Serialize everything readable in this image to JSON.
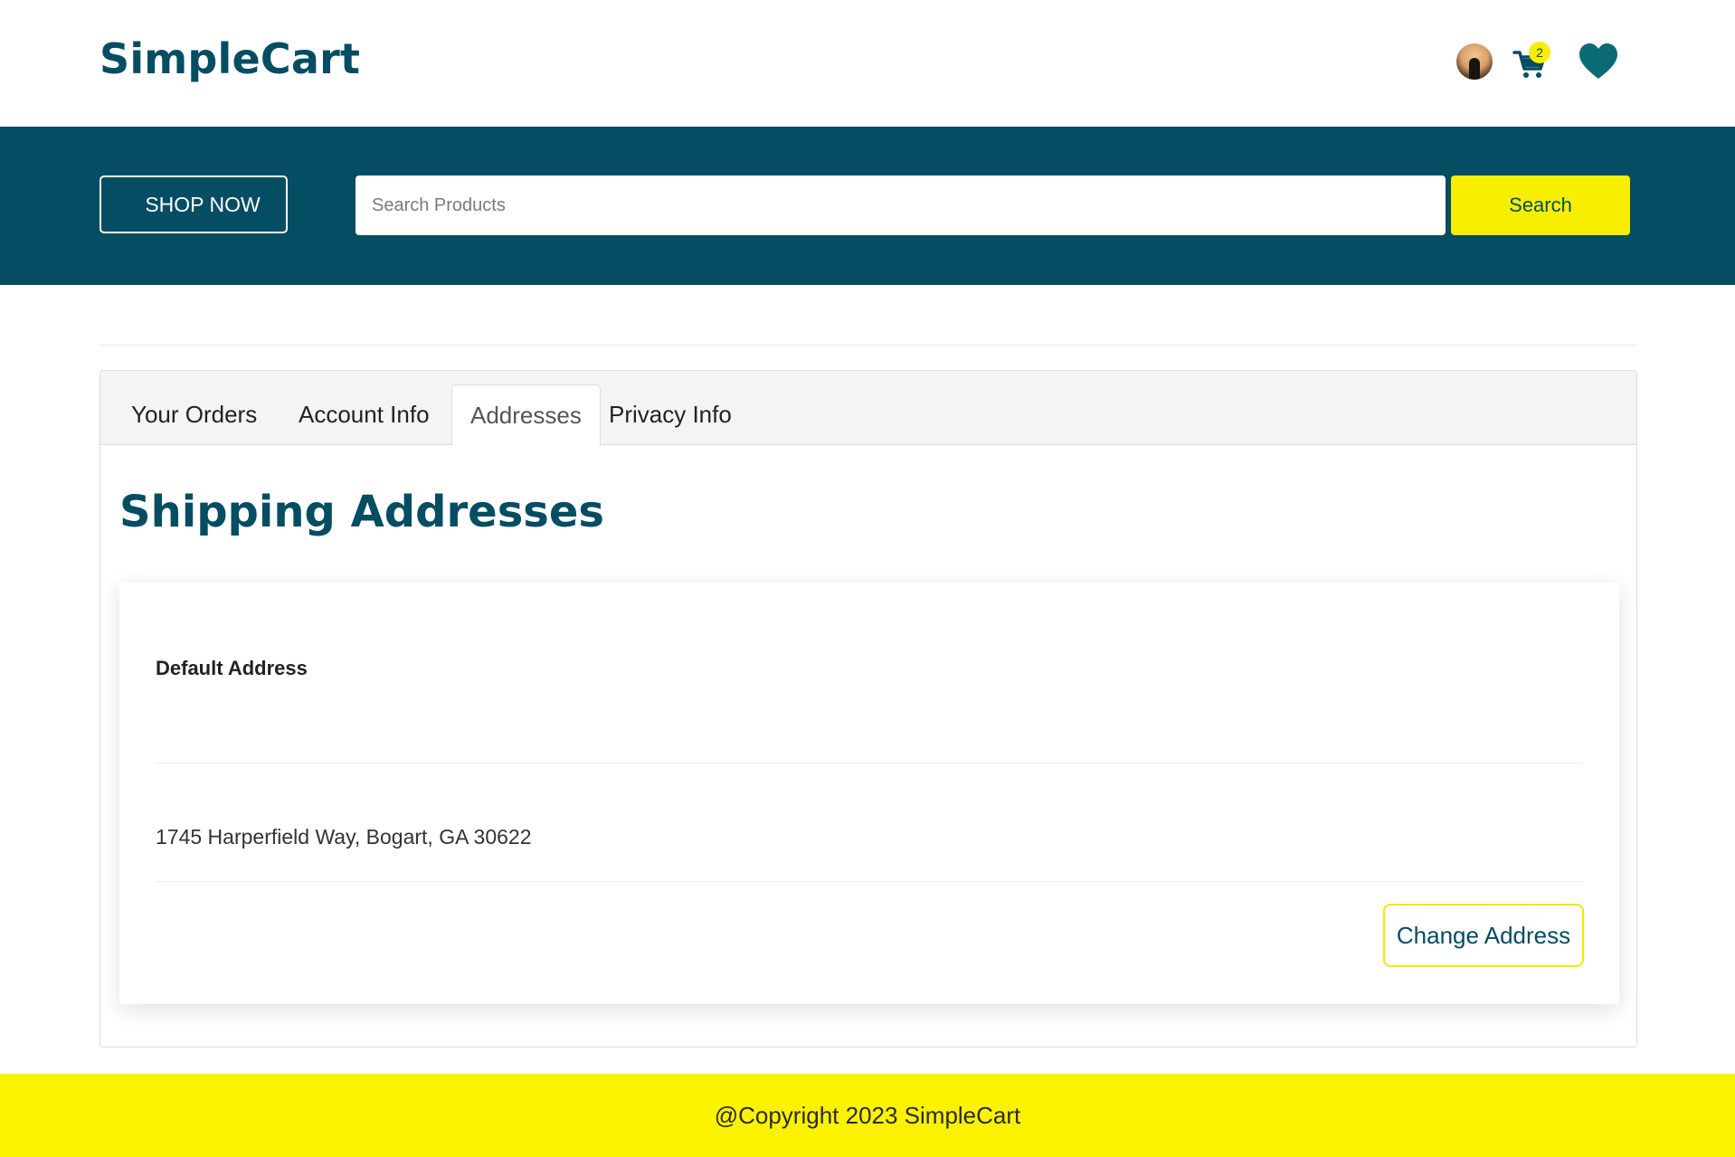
{
  "header": {
    "logo": "SimpleCart",
    "cart_count": "2",
    "icons": [
      "user-avatar",
      "cart-icon",
      "heart-icon"
    ],
    "brand_color": "#044d62",
    "accent_color": "#f8ee00"
  },
  "banner": {
    "shop_now_label": "SHOP NOW",
    "search_placeholder": "Search Products",
    "search_value": "",
    "search_button_label": "Search"
  },
  "tabs": [
    {
      "label": "Your Orders",
      "active": false
    },
    {
      "label": "Account Info",
      "active": false
    },
    {
      "label": "Addresses",
      "active": true
    },
    {
      "label": "Privacy Info",
      "active": false
    }
  ],
  "main": {
    "title": "Shipping Addresses",
    "address_card": {
      "label": "Default Address",
      "address": "1745 Harperfield Way, Bogart, GA 30622",
      "change_button_label": "Change Address"
    }
  },
  "footer": {
    "copyright": "@Copyright 2023 SimpleCart"
  }
}
